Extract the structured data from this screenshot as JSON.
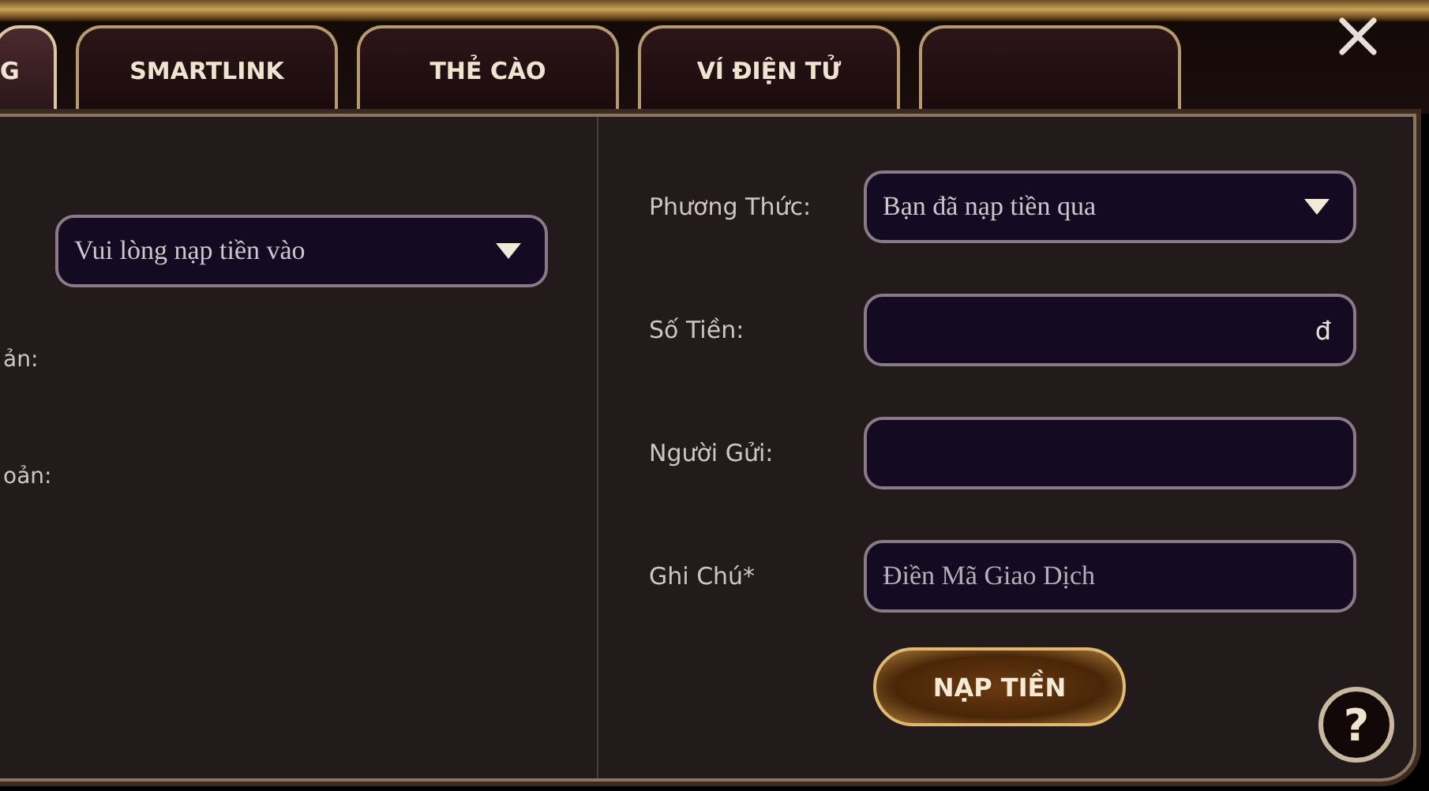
{
  "tabs": [
    {
      "label": "G",
      "selected": true
    },
    {
      "label": "SMARTLINK",
      "selected": false
    },
    {
      "label": "THẺ CÀO",
      "selected": false
    },
    {
      "label": "VÍ ĐIỆN TỬ",
      "selected": false
    },
    {
      "selected": false
    }
  ],
  "left": {
    "dropdown": {
      "value": "Vui lòng nạp tiền vào"
    },
    "labels": [
      "ản:",
      "oản:"
    ]
  },
  "form": [
    {
      "kind": "select",
      "label": "Phương Thức:",
      "value": "Bạn đã nạp tiền qua"
    },
    {
      "kind": "amount",
      "label": "Số Tiền:",
      "suffix": "đ"
    },
    {
      "kind": "text",
      "label": "Người Gửi:"
    },
    {
      "kind": "text",
      "label": "Ghi Chú*",
      "placeholder": "Điền Mã Giao Dịch"
    }
  ],
  "submit": "NẠP TIỀN",
  "help": "?"
}
